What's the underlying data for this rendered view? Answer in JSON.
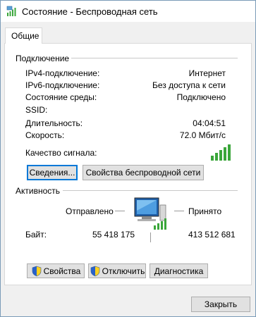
{
  "window": {
    "title": "Состояние - Беспроводная сеть"
  },
  "tabs": [
    {
      "label": "Общие",
      "selected": true
    }
  ],
  "connection": {
    "group_title": "Подключение",
    "rows": [
      {
        "label": "IPv4-подключение:",
        "value": "Интернет"
      },
      {
        "label": "IPv6-подключение:",
        "value": "Без доступа к сети"
      },
      {
        "label": "Состояние среды:",
        "value": "Подключено"
      },
      {
        "label": "SSID:",
        "value": ""
      },
      {
        "label": "Длительность:",
        "value": "04:04:51"
      },
      {
        "label": "Скорость:",
        "value": "72.0 Мбит/с"
      }
    ],
    "signal_label": "Качество сигнала:",
    "signal_bars_lit": 5,
    "signal_bars_total": 5,
    "details_button": "Сведения...",
    "wireless_props_button": "Свойства беспроводной сети"
  },
  "activity": {
    "group_title": "Активность",
    "sent_label": "Отправлено",
    "received_label": "Принято",
    "bytes_label": "Байт:",
    "bytes_sent": "55 418 175",
    "bytes_received": "413 512 681"
  },
  "buttons": {
    "properties": "Свойства",
    "disable": "Отключить",
    "diagnose": "Диагностика",
    "close": "Закрыть"
  },
  "colors": {
    "signal_green": "#3aa63a",
    "focus_blue": "#0078d7",
    "button_face": "#e1e1e1",
    "dialog_bg": "#f0f0f0"
  },
  "icons": {
    "title": "wireless-network-icon",
    "signal": "signal-strength-icon",
    "network": "network-computer-icon",
    "shield": "uac-shield-icon"
  }
}
